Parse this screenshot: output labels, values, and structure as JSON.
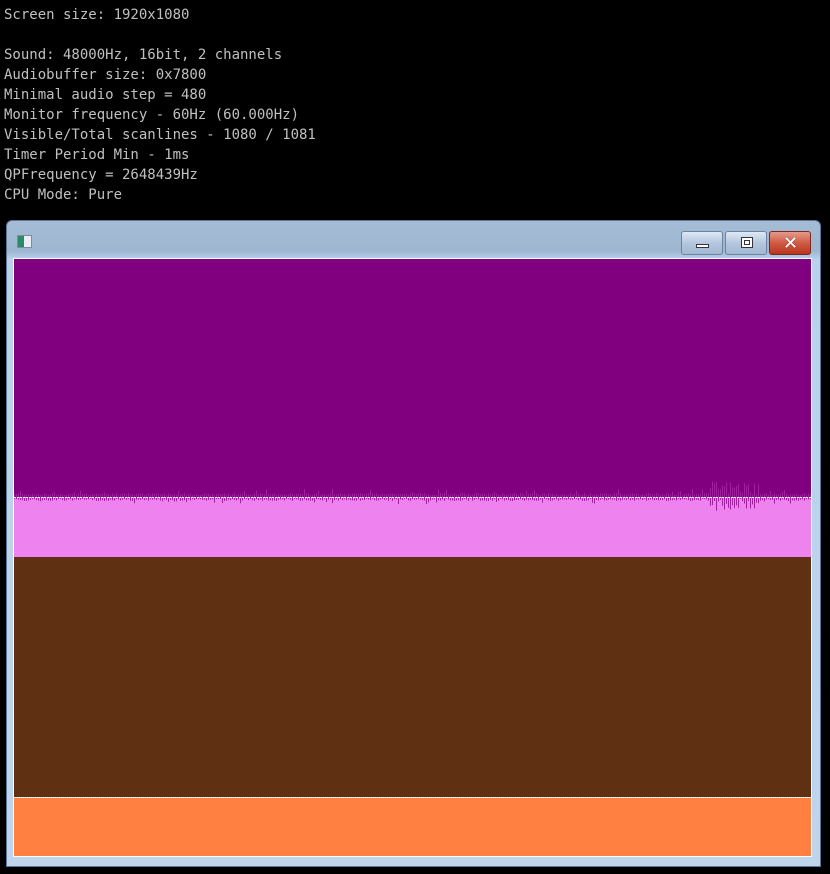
{
  "console": {
    "lines": [
      "Screen size: 1920x1080",
      "",
      "Sound: 48000Hz, 16bit, 2 channels",
      "Audiobuffer size: 0x7800",
      "Minimal audio step = 480",
      "Monitor frequency - 60Hz (60.000Hz)",
      "Visible/Total scanlines - 1080 / 1081",
      "Timer Period Min - 1ms",
      "QPFrequency = 2648439Hz",
      "CPU Mode: Pure"
    ]
  },
  "window": {
    "buttons": {
      "minimize": "minimize-icon",
      "maximize": "maximize-icon",
      "close": "close-icon",
      "close_glyph": "✕"
    }
  },
  "colors": {
    "purple": "#800080",
    "pink": "#ee82ee",
    "brown": "#603012",
    "orange": "#ff8040"
  }
}
